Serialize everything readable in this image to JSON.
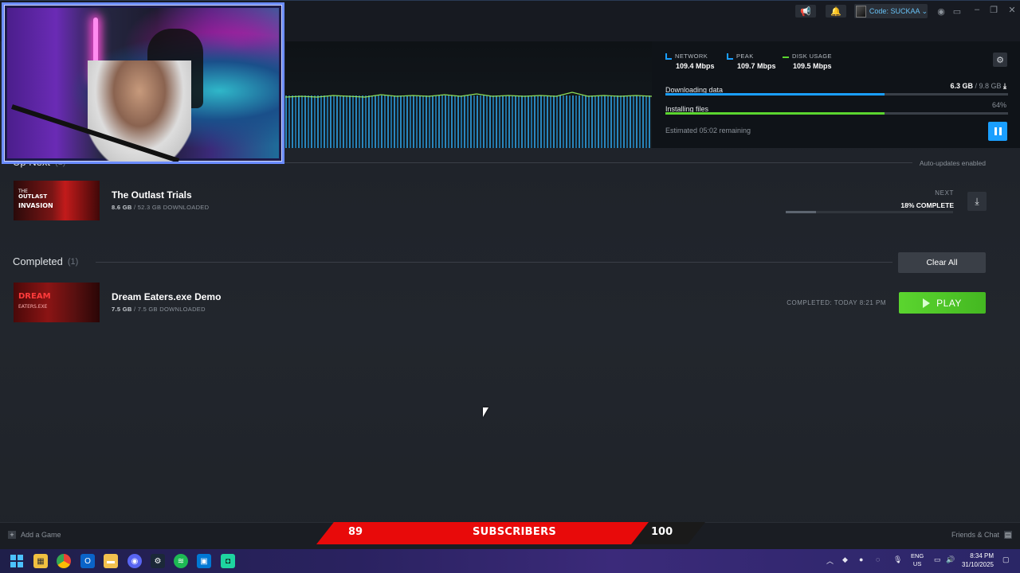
{
  "titlebar": {
    "user_name": "Code: SUCKAA ⌄"
  },
  "download": {
    "stats": [
      {
        "label": "NETWORK",
        "value": "109.4 Mbps",
        "color": "#1a9fff"
      },
      {
        "label": "PEAK",
        "value": "109.7 Mbps",
        "color": "#1a9fff"
      },
      {
        "label": "DISK USAGE",
        "value": "109.5 Mbps",
        "color": "#5bd52f"
      }
    ],
    "downloading_label": "Downloading data",
    "downloading_done": "6.3 GB",
    "downloading_total": " / 9.8 GB",
    "downloading_progress": 0.64,
    "installing_label": "Installing files",
    "installing_pct": "64%",
    "installing_progress": 0.64,
    "eta": "Estimated 05:02 remaining"
  },
  "up_next": {
    "heading": "Up Next",
    "count": "(1)",
    "auto_updates": "Auto-updates enabled",
    "game": {
      "title": "The Outlast Trials",
      "downloaded": "8.6 GB",
      "total": " / 52.3 GB DOWNLOADED",
      "next_label": "NEXT",
      "percent": "18% COMPLETE",
      "progress": 0.18,
      "cover_line1": "THE",
      "cover_line2": "OUTLAST",
      "cover_line3": "INVASION"
    }
  },
  "completed": {
    "heading": "Completed",
    "count": "(1)",
    "clear_all": "Clear All",
    "game": {
      "title": "Dream Eaters.exe Demo",
      "downloaded": "7.5 GB",
      "total": " / 7.5 GB DOWNLOADED",
      "completed_at": "COMPLETED: TODAY 8:21 PM",
      "play": "PLAY",
      "cover_line1": "DREAM",
      "cover_line2": "EATERS.EXE"
    }
  },
  "bottom_bar": {
    "add_game": "Add a Game",
    "friends_chat": "Friends & Chat"
  },
  "subscriber_banner": {
    "current": "89",
    "label": "SUBSCRIBERS",
    "goal": "100"
  },
  "taskbar": {
    "lang_top": "ENG",
    "lang_bottom": "US",
    "time": "8:34 PM",
    "date": "31/10/2025"
  },
  "colors": {
    "accent_blue": "#1a9fff",
    "accent_green": "#5bd52f",
    "banner_red": "#e80a0a"
  }
}
